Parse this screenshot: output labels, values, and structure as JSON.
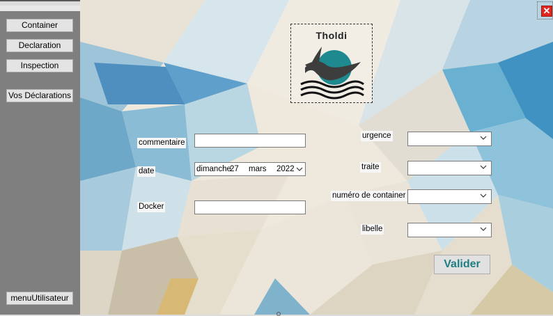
{
  "window": {
    "close_icon": "close-icon"
  },
  "sidebar": {
    "items": [
      {
        "label": "Container"
      },
      {
        "label": "Declaration"
      },
      {
        "label": "Inspection"
      },
      {
        "label": "Vos Déclarations"
      }
    ],
    "footer_label": "menuUtilisateur"
  },
  "logo": {
    "title": "Tholdi",
    "icon": "whale-wave-logo",
    "colors": {
      "circle": "#1e8a8f",
      "whale": "#3a3a3a",
      "waves": "#111111"
    }
  },
  "form": {
    "commentaire": {
      "label": "commentaire",
      "value": ""
    },
    "date": {
      "label": "date",
      "weekday": "dimanche",
      "day": "27",
      "month": "mars",
      "year": "2022"
    },
    "docker": {
      "label": "Docker",
      "value": ""
    },
    "urgence": {
      "label": "urgence",
      "selected": ""
    },
    "traite": {
      "label": "traite",
      "selected": ""
    },
    "numero_container": {
      "label": "numéro de container",
      "selected": ""
    },
    "libelle": {
      "label": "libelle",
      "selected": ""
    },
    "submit_label": "Valider"
  },
  "colors": {
    "sidebar": "#7f7f7f",
    "accent": "#1d7e84",
    "close": "#e0261f"
  }
}
